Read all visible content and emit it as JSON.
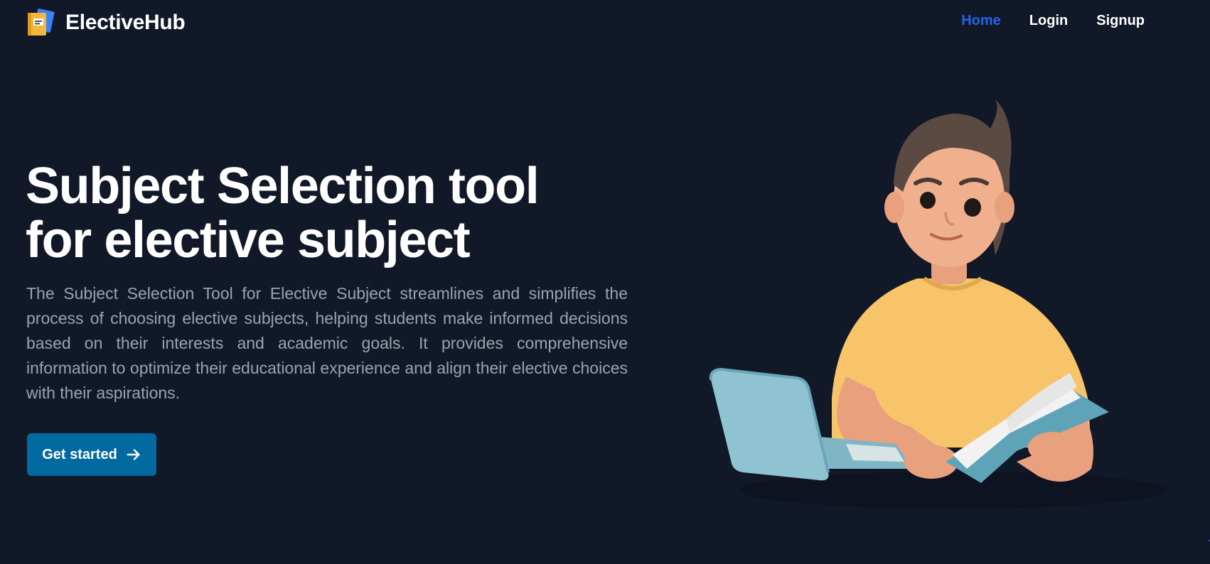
{
  "brand": {
    "name": "ElectiveHub",
    "logo_icon": "notebook-icon"
  },
  "nav": {
    "items": [
      {
        "label": "Home",
        "active": true
      },
      {
        "label": "Login",
        "active": false
      },
      {
        "label": "Signup",
        "active": false
      }
    ]
  },
  "hero": {
    "title_line1": "Subject Selection tool",
    "title_line2": "for elective subject",
    "description": "The Subject Selection Tool for Elective Subject streamlines and simplifies the process of choosing elective subjects, helping students make informed decisions based on their interests and academic goals. It provides comprehensive information to optimize their educational experience and align their elective choices with their aspirations.",
    "cta_label": "Get started",
    "cta_icon": "arrow-right-icon",
    "illustration": "student-with-laptop-and-book-illustration"
  },
  "colors": {
    "background": "#111827",
    "accent": "#2563eb",
    "button": "#0369a1",
    "muted_text": "#9ca3af"
  }
}
